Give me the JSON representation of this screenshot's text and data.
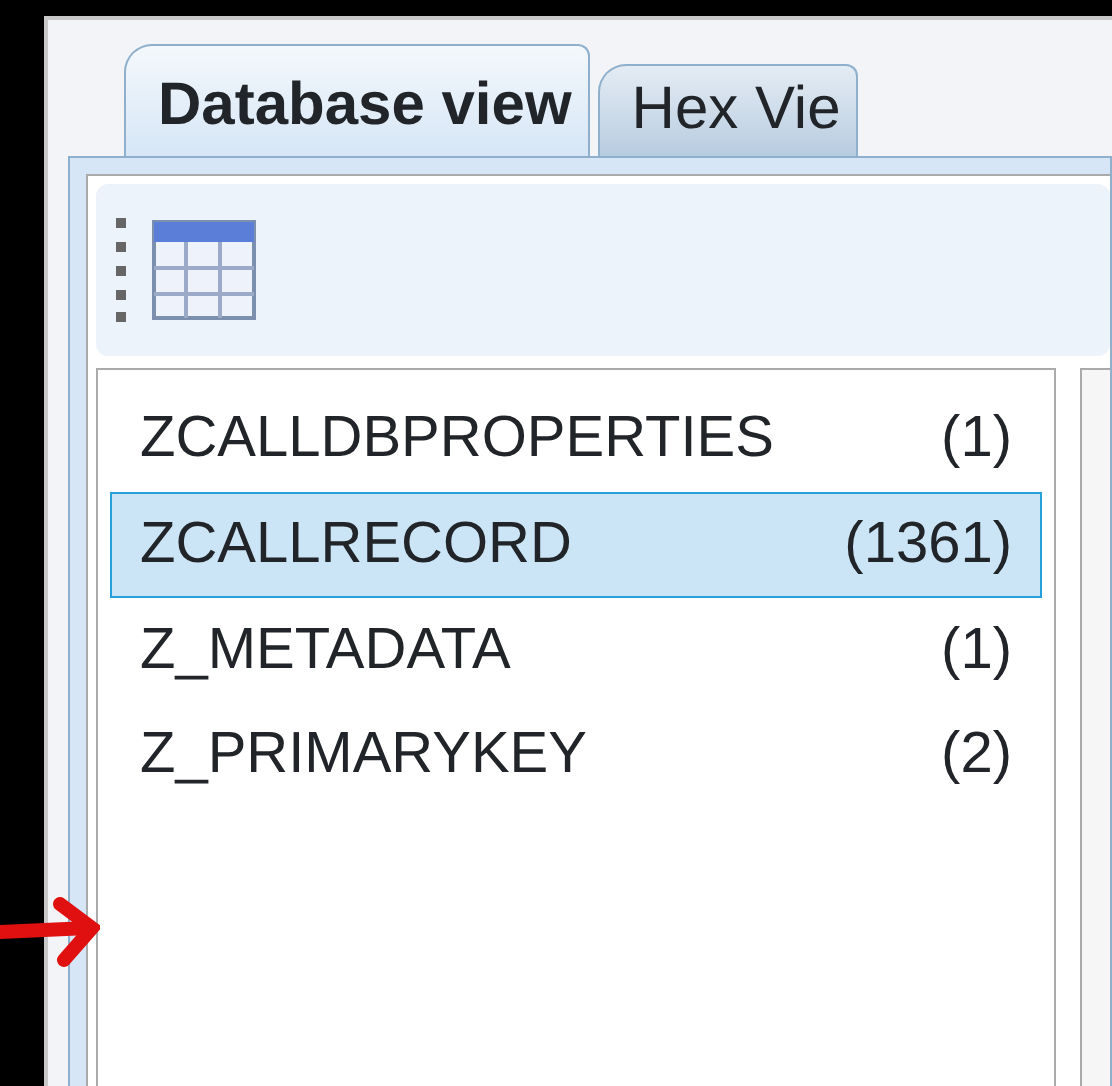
{
  "tabs": [
    {
      "label": "Database view",
      "selected": true
    },
    {
      "label": "Hex Vie",
      "selected": false
    }
  ],
  "tables": [
    {
      "name": "ZCALLDBPROPERTIES",
      "count": "(1)",
      "selected": false
    },
    {
      "name": "ZCALLRECORD",
      "count": "(1361)",
      "selected": true
    },
    {
      "name": "Z_METADATA",
      "count": "(1)",
      "selected": false
    },
    {
      "name": "Z_PRIMARYKEY",
      "count": "(2)",
      "selected": false
    }
  ]
}
